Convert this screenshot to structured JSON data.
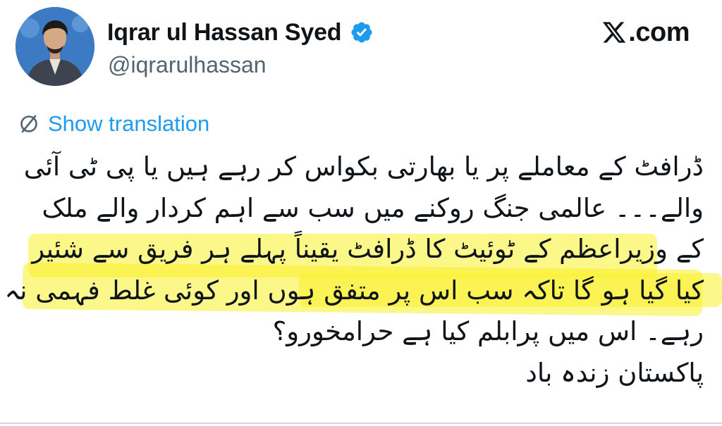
{
  "tweet": {
    "display_name": "Iqrar ul Hassan Syed",
    "handle": "@iqrarulhassan",
    "verified": true,
    "show_translation_label": "Show translation",
    "lines": [
      "ڈرافٹ کے معاملے پر یا بھارتی بکواس کر رہے ہیں یا پی ٹی آئی",
      "والے۔۔۔ عالمی جنگ روکنے میں سب سے اہم کردار والے ملک",
      "کے وزیراعظم کے ٹوئیٹ کا ڈرافٹ یقیناً پہلے ہر فریق سے شئیر",
      "کیا گیا ہو گا تاکہ سب اس پر متفق ہوں اور کوئی غلط فہمی نہ",
      "رہے۔ اس میں پرابلم کیا ہے حرامخورو؟",
      "پاکستان زندہ باد"
    ]
  },
  "brand": {
    "logo_icon": "x-logo-icon",
    "domain_suffix": ".com"
  },
  "colors": {
    "link_blue": "#1d9bf0",
    "handle_gray": "#536471",
    "highlight_yellow": "#faf028",
    "verified_blue": "#1d9bf0"
  }
}
